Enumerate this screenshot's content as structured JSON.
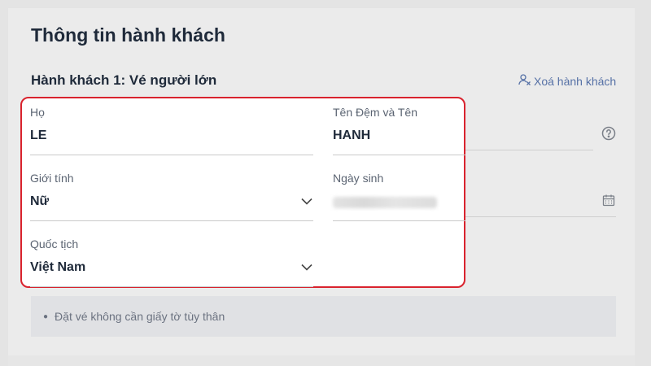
{
  "page": {
    "title": "Thông tin hành khách",
    "passenger_heading": "Hành khách 1: Vé người lớn",
    "remove_passenger_label": "Xoá hành khách"
  },
  "form": {
    "last_name": {
      "label": "Họ",
      "value": "LE"
    },
    "first_name": {
      "label": "Tên Đệm và Tên",
      "value": "HANH"
    },
    "gender": {
      "label": "Giới tính",
      "value": "Nữ"
    },
    "birthdate": {
      "label": "Ngày sinh"
    },
    "nationality": {
      "label": "Quốc tịch",
      "value": "Việt Nam"
    }
  },
  "notice": {
    "text": "Đặt vé không cần giấy tờ tùy thân"
  },
  "icons": {
    "remove": "user-remove-icon",
    "help": "question-circle-icon",
    "calendar": "calendar-icon",
    "dropdown": "chevron-down-icon"
  },
  "colors": {
    "highlight_border": "#d9232e",
    "link": "#5671a6",
    "text_dark": "#1f2a3a"
  }
}
